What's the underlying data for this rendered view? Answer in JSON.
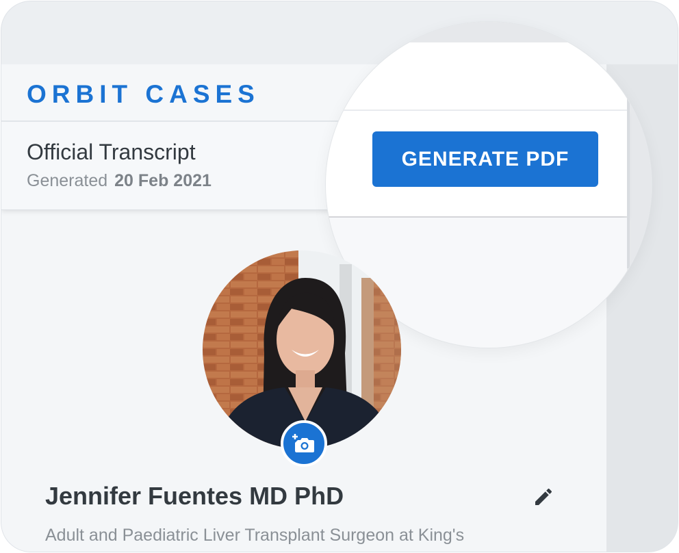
{
  "brand": {
    "name": "ORBIT CASES"
  },
  "document": {
    "title": "Official Transcript",
    "generated_label": "Generated",
    "generated_date": "20 Feb 2021"
  },
  "actions": {
    "generate_pdf_label": "GENERATE PDF"
  },
  "profile": {
    "name": "Jennifer Fuentes MD PhD",
    "subtitle": "Adult and Paediatric Liver Transplant Surgeon at King's",
    "avatar_icon": "add-photo-icon",
    "edit_icon": "pencil-icon"
  },
  "colors": {
    "accent": "#1b73d3",
    "text_primary": "#333a40",
    "text_secondary": "#8a9096"
  }
}
